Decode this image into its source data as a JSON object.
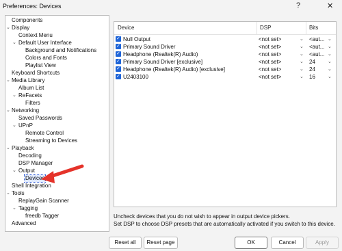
{
  "window": {
    "title": "Preferences: Devices",
    "help_glyph": "?",
    "close_glyph": "✕"
  },
  "tree": {
    "items": [
      {
        "label": "Components"
      },
      {
        "label": "Display"
      },
      {
        "label": "Context Menu"
      },
      {
        "label": "Default User Interface"
      },
      {
        "label": "Background and Notifications"
      },
      {
        "label": "Colors and Fonts"
      },
      {
        "label": "Playlist View"
      },
      {
        "label": "Keyboard Shortcuts"
      },
      {
        "label": "Media Library"
      },
      {
        "label": "Album List"
      },
      {
        "label": "ReFacets"
      },
      {
        "label": "Filters"
      },
      {
        "label": "Networking"
      },
      {
        "label": "Saved Passwords"
      },
      {
        "label": "UPnP"
      },
      {
        "label": "Remote Control"
      },
      {
        "label": "Streaming to Devices"
      },
      {
        "label": "Playback"
      },
      {
        "label": "Decoding"
      },
      {
        "label": "DSP Manager"
      },
      {
        "label": "Output"
      },
      {
        "label": "Devices"
      },
      {
        "label": "Shell Integration"
      },
      {
        "label": "Tools"
      },
      {
        "label": "ReplayGain Scanner"
      },
      {
        "label": "Tagging"
      },
      {
        "label": "freedb Tagger"
      },
      {
        "label": "Advanced"
      }
    ]
  },
  "devices": {
    "headers": {
      "device": "Device",
      "dsp": "DSP",
      "bits": "Bits"
    },
    "rows": [
      {
        "name": "Null Output",
        "dsp": "<not set>",
        "bits": "<aut..."
      },
      {
        "name": "Primary Sound Driver",
        "dsp": "<not set>",
        "bits": "<aut..."
      },
      {
        "name": "Headphone (Realtek(R) Audio)",
        "dsp": "<not set>",
        "bits": "<aut..."
      },
      {
        "name": "Primary Sound Driver [exclusive]",
        "dsp": "<not set>",
        "bits": "24"
      },
      {
        "name": "Headphone (Realtek(R) Audio) [exclusive]",
        "dsp": "<not set>",
        "bits": "24"
      },
      {
        "name": "U2403100",
        "dsp": "<not set>",
        "bits": "16"
      }
    ]
  },
  "info": {
    "line1": "Uncheck devices that you do not wish to appear in output device pickers.",
    "line2": "Set DSP to choose DSP presets that are automatically activated if you switch to this device."
  },
  "buttons": {
    "reset_all": "Reset all",
    "reset_page": "Reset page",
    "ok": "OK",
    "cancel": "Cancel",
    "apply": "Apply"
  },
  "colors": {
    "checkbox": "#1e64d8",
    "selection_outline": "#2a58d6",
    "annotation_arrow": "#e5332a"
  }
}
